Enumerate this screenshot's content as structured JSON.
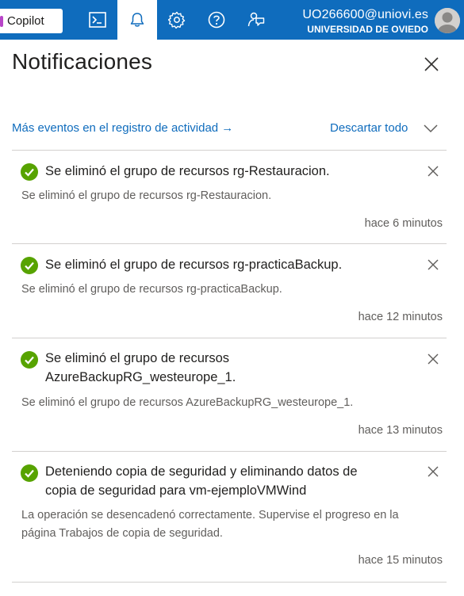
{
  "topbar": {
    "copilot_label": "Copilot",
    "icons": [
      "cloud-shell-icon",
      "bell-icon",
      "gear-icon",
      "help-icon",
      "feedback-icon"
    ],
    "user_email": "UO266600@uniovi.es",
    "user_org": "UNIVERSIDAD DE OVIEDO"
  },
  "panel": {
    "title": "Notificaciones",
    "activity_link": "Más eventos en el registro de actividad →",
    "dismiss_label": "Descartar todo"
  },
  "notifications": [
    {
      "title": "Se eliminó el grupo de recursos rg-Restauracion.",
      "description": "Se eliminó el grupo de recursos rg-Restauracion.",
      "time": "hace 6 minutos"
    },
    {
      "title": "Se eliminó el grupo de recursos rg-practicaBackup.",
      "description": "Se eliminó el grupo de recursos rg-practicaBackup.",
      "time": "hace 12 minutos"
    },
    {
      "title_line1": "Se eliminó el grupo de recursos",
      "title_line2": "AzureBackupRG_westeurope_1.",
      "description": "Se eliminó el grupo de recursos AzureBackupRG_westeurope_1.",
      "time": "hace 13 minutos"
    },
    {
      "title_line1": "Deteniendo copia de seguridad y eliminando datos de",
      "title_line2": "copia de seguridad para vm-ejemploVMWind",
      "description_line1": "La operación se desencadenó correctamente. Supervise el progreso en la",
      "description_line2": "página Trabajos de copia de seguridad.",
      "time": "hace 15 minutos"
    }
  ],
  "colors": {
    "topbar": "#0f6cbd",
    "link": "#0f6cbd",
    "success": "#57a300"
  }
}
